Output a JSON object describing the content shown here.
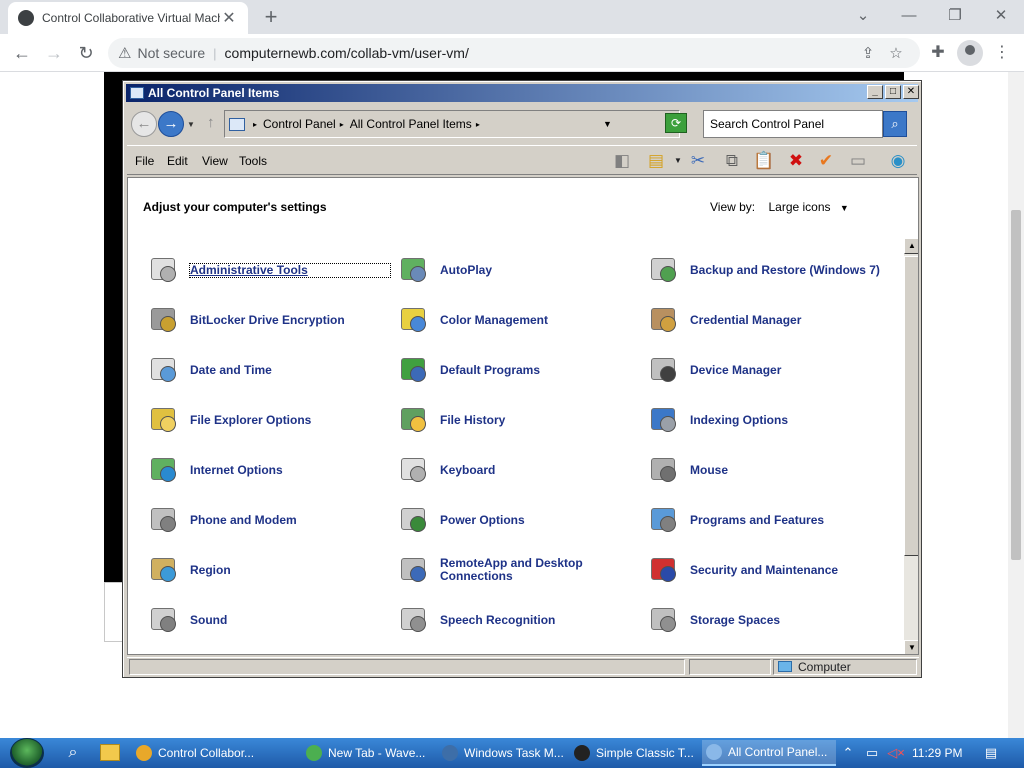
{
  "browser": {
    "tab_title": "Control Collaborative Virtual Machine",
    "url_prefix": "Not secure",
    "url": "computernewb.com/collab-vm/user-vm/"
  },
  "window": {
    "title": "All Control Panel Items",
    "breadcrumbs": [
      "Control Panel",
      "All Control Panel Items"
    ],
    "search_placeholder": "Search Control Panel",
    "menu": [
      "File",
      "Edit",
      "View",
      "Tools"
    ],
    "heading": "Adjust your computer's settings",
    "view_by_label": "View by:",
    "view_by_value": "Large icons",
    "items": [
      [
        "Administrative Tools",
        "AutoPlay",
        "Backup and Restore (Windows 7)"
      ],
      [
        "BitLocker Drive Encryption",
        "Color Management",
        "Credential Manager"
      ],
      [
        "Date and Time",
        "Default Programs",
        "Device Manager"
      ],
      [
        "File Explorer Options",
        "File History",
        "Indexing Options"
      ],
      [
        "Internet Options",
        "Keyboard",
        "Mouse"
      ],
      [
        "Phone and Modem",
        "Power Options",
        "Programs and Features"
      ],
      [
        "Region",
        "RemoteApp and Desktop Connections",
        "Security and Maintenance"
      ],
      [
        "Sound",
        "Speech Recognition",
        "Storage Spaces"
      ]
    ],
    "status_location": "Computer"
  },
  "taskbar": {
    "tasks": [
      {
        "label": "Control Collabor...",
        "color": "#e8a82a"
      },
      {
        "label": "New Tab - Wave...",
        "color": "#4caf50"
      },
      {
        "label": "Windows Task M...",
        "color": "#3d6ea8"
      },
      {
        "label": "Simple Classic T...",
        "color": "#222222"
      },
      {
        "label": "All Control Panel...",
        "color": "#8ab8e8"
      }
    ],
    "clock": "11:29 PM"
  }
}
